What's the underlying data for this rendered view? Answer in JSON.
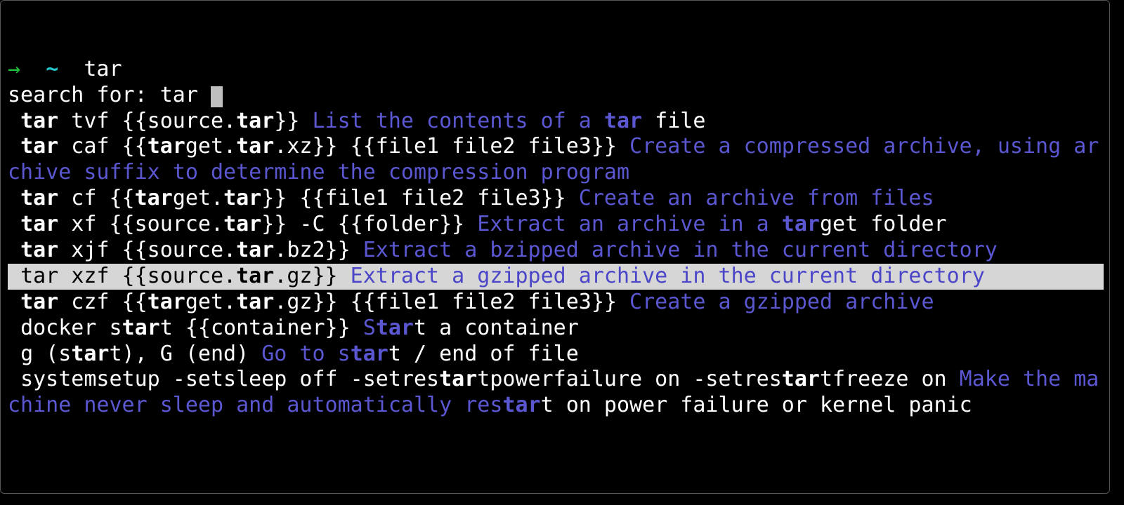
{
  "prompt": {
    "arrow": "→",
    "tilde": "~",
    "typed": "tar"
  },
  "search": {
    "label": "search for:",
    "query": "tar"
  },
  "rows": [
    {
      "indent": " ",
      "cmd": [
        {
          "t": "tar",
          "b": true
        },
        {
          "t": " tvf {{source."
        },
        {
          "t": "tar",
          "b": true
        },
        {
          "t": "}}"
        }
      ],
      "desc": [
        {
          "t": " List the contents of a "
        },
        {
          "t": "tar",
          "b": true
        },
        {
          "t": " file",
          "w": true
        }
      ]
    },
    {
      "indent": " ",
      "cmd": [
        {
          "t": "tar",
          "b": true
        },
        {
          "t": " caf {{"
        },
        {
          "t": "tar",
          "b": true
        },
        {
          "t": "get."
        },
        {
          "t": "tar",
          "b": true
        },
        {
          "t": ".xz}} {{file1 file2 file3}}"
        }
      ],
      "desc": [
        {
          "t": " Create a compressed archive, using archive suffix to determine the compression program"
        }
      ]
    },
    {
      "indent": " ",
      "cmd": [
        {
          "t": "tar",
          "b": true
        },
        {
          "t": " cf {{"
        },
        {
          "t": "tar",
          "b": true
        },
        {
          "t": "get."
        },
        {
          "t": "tar",
          "b": true
        },
        {
          "t": "}} {{file1 file2 file3}}"
        }
      ],
      "desc": [
        {
          "t": " Create an archive from files"
        }
      ]
    },
    {
      "indent": " ",
      "cmd": [
        {
          "t": "tar",
          "b": true
        },
        {
          "t": " xf {{source."
        },
        {
          "t": "tar",
          "b": true
        },
        {
          "t": "}} -C {{folder}}"
        }
      ],
      "desc": [
        {
          "t": " Extract an archive in a "
        },
        {
          "t": "tar",
          "b": true
        },
        {
          "t": "get folder",
          "w": true
        }
      ]
    },
    {
      "indent": " ",
      "cmd": [
        {
          "t": "tar",
          "b": true
        },
        {
          "t": " xjf {{source."
        },
        {
          "t": "tar",
          "b": true
        },
        {
          "t": ".bz2}}"
        }
      ],
      "desc": [
        {
          "t": " Extract a bzipped archive in the current directory"
        }
      ]
    },
    {
      "selected": true,
      "indent": " ",
      "cmd": [
        {
          "t": "tar "
        },
        {
          "t": "xzf {{source."
        },
        {
          "t": "tar",
          "b": true
        },
        {
          "t": ".gz}}"
        }
      ],
      "desc": [
        {
          "t": " Extract a gzipped archive in the current directory"
        }
      ]
    },
    {
      "indent": " ",
      "cmd": [
        {
          "t": "tar",
          "b": true
        },
        {
          "t": " czf {{"
        },
        {
          "t": "tar",
          "b": true
        },
        {
          "t": "get."
        },
        {
          "t": "tar",
          "b": true
        },
        {
          "t": ".gz}} {{file1 file2 file3}}"
        }
      ],
      "desc": [
        {
          "t": " Create a gzipped archive"
        }
      ]
    },
    {
      "indent": " ",
      "cmd": [
        {
          "t": "docker s"
        },
        {
          "t": "tar",
          "b": true
        },
        {
          "t": "t {{container}}"
        }
      ],
      "desc": [
        {
          "t": " S"
        },
        {
          "t": "tar",
          "b": true
        },
        {
          "t": "t a container",
          "w": true
        }
      ]
    },
    {
      "indent": " ",
      "cmd": [
        {
          "t": "g (s"
        },
        {
          "t": "tar",
          "b": true
        },
        {
          "t": "t), G (end)"
        }
      ],
      "desc": [
        {
          "t": " Go to s"
        },
        {
          "t": "tar",
          "b": true
        },
        {
          "t": "t / end of file",
          "w": true
        }
      ]
    },
    {
      "indent": " ",
      "cmd": [
        {
          "t": "systemsetup -setsleep off -setres"
        },
        {
          "t": "tar",
          "b": true
        },
        {
          "t": "tpowerfailure on -setres"
        },
        {
          "t": "tar",
          "b": true
        },
        {
          "t": "tfreeze on"
        }
      ],
      "desc": [
        {
          "t": " Make the machine never sleep and automatically res"
        },
        {
          "t": "tar",
          "b": true
        },
        {
          "t": "t on power failure or kernel panic",
          "w": true
        }
      ]
    }
  ]
}
